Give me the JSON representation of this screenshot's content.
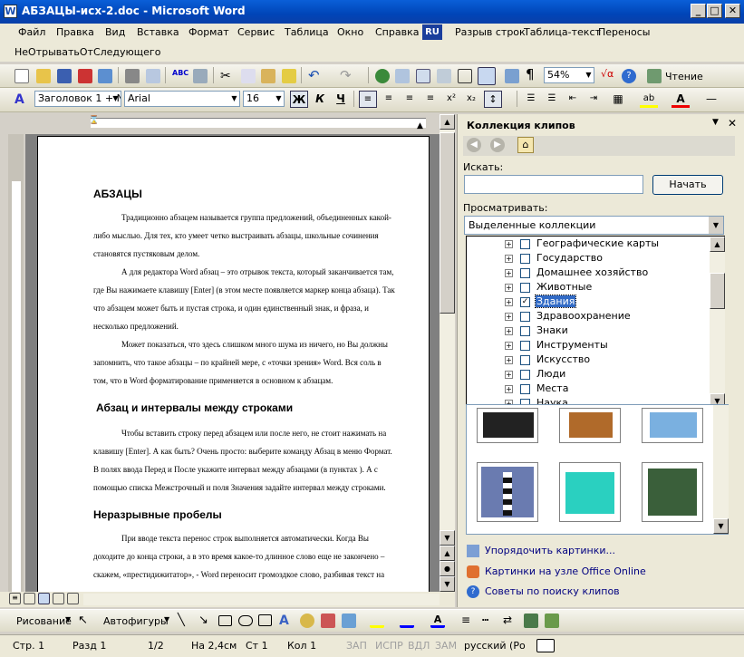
{
  "window": {
    "title": "АБЗАЦЫ-исх-2.doc - Microsoft Word",
    "icon": "W"
  },
  "menu": [
    "Файл",
    "Правка",
    "Вид",
    "Вставка",
    "Формат",
    "Сервис",
    "Таблица",
    "Окно",
    "Справка"
  ],
  "menu_extra": {
    "lang": "RU",
    "items": [
      "Разрыв строк",
      "Таблица-текст",
      "Переносы"
    ],
    "row2": "НеОтрыватьОтСледующего"
  },
  "toolbar": {
    "zoom": "54%",
    "reading": "Чтение"
  },
  "format": {
    "style": "Заголовок 1 + N",
    "font": "Arial",
    "size": "16",
    "bold": "Ж",
    "italic": "К",
    "underline": "Ч"
  },
  "document": {
    "h1": "АБЗАЦЫ",
    "p1": [
      "Традиционно абзацем называется группа предложений, объединенных какой-",
      "либо мыслью. Для тех, кто умеет четко выстраивать абзацы, школьные сочинения",
      "становятся пустяковым делом."
    ],
    "p2": [
      "А для редактора Word абзац – это отрывок текста, который заканчивается там,",
      "где Вы нажимаете клавишу [Enter] (в этом месте появляется маркер конца абзаца). Так",
      "что абзацем может быть и пустая строка, и один единственный знак, и фраза, и",
      "несколько предложений."
    ],
    "p3": [
      "Может показаться, что здесь слишком много шума из ничего, но Вы должны",
      "запомнить, что такое абзацы – по крайней мере, с «точки зрения» Word. Вся соль в",
      "том, что в Word форматирование применяется в основном к абзацам."
    ],
    "h2": "Абзац и интервалы между строками",
    "p4": [
      "Чтобы вставить строку перед абзацем или после него, не стоит нажимать на",
      "клавишу [Enter]. А как быть? Очень просто: выберите команду Абзац в меню Формат.",
      "В полях ввода Перед и После укажите интервал между абзацами (в пунктах ). А с",
      "помощью списка Межстрочный и поля Значения задайте интервал между строками."
    ],
    "h3": "Неразрывные пробелы",
    "p5": [
      "При вводе текста перенос строк выполняется автоматически. Когда Вы",
      "доходите до конца строки, а в это время какое-то длинное слово еще не закончено –",
      "скажем, «престидижитатор», - Word переносит громоздкое слово, разбивая текст на"
    ]
  },
  "pane": {
    "title": "Коллекция клипов",
    "search_label": "Искать:",
    "search_value": "",
    "go": "Начать",
    "browse_label": "Просматривать:",
    "browse_value": "Выделенные коллекции",
    "tree": [
      {
        "label": "Географические карты",
        "checked": false
      },
      {
        "label": "Государство",
        "checked": false
      },
      {
        "label": "Домашнее хозяйство",
        "checked": false
      },
      {
        "label": "Животные",
        "checked": false
      },
      {
        "label": "Здания",
        "checked": true,
        "selected": true
      },
      {
        "label": "Здравоохранение",
        "checked": false
      },
      {
        "label": "Знаки",
        "checked": false
      },
      {
        "label": "Инструменты",
        "checked": false
      },
      {
        "label": "Искусство",
        "checked": false
      },
      {
        "label": "Люди",
        "checked": false
      },
      {
        "label": "Места",
        "checked": false
      },
      {
        "label": "Наука",
        "checked": false
      }
    ],
    "links": [
      "Упорядочить картинки...",
      "Картинки на узле Office Online",
      "Советы по поиску клипов"
    ]
  },
  "drawing": {
    "draw": "Рисование",
    "autoshapes": "Автофигуры"
  },
  "status": {
    "page": "Стр. 1",
    "section": "Разд 1",
    "pages": "1/2",
    "at": "На 2,4см",
    "line": "Ст 1",
    "col": "Кол 1",
    "rec": "ЗАП",
    "trk": "ИСПР",
    "ext": "ВДЛ",
    "ovr": "ЗАМ",
    "lang": "русский (Ро"
  }
}
